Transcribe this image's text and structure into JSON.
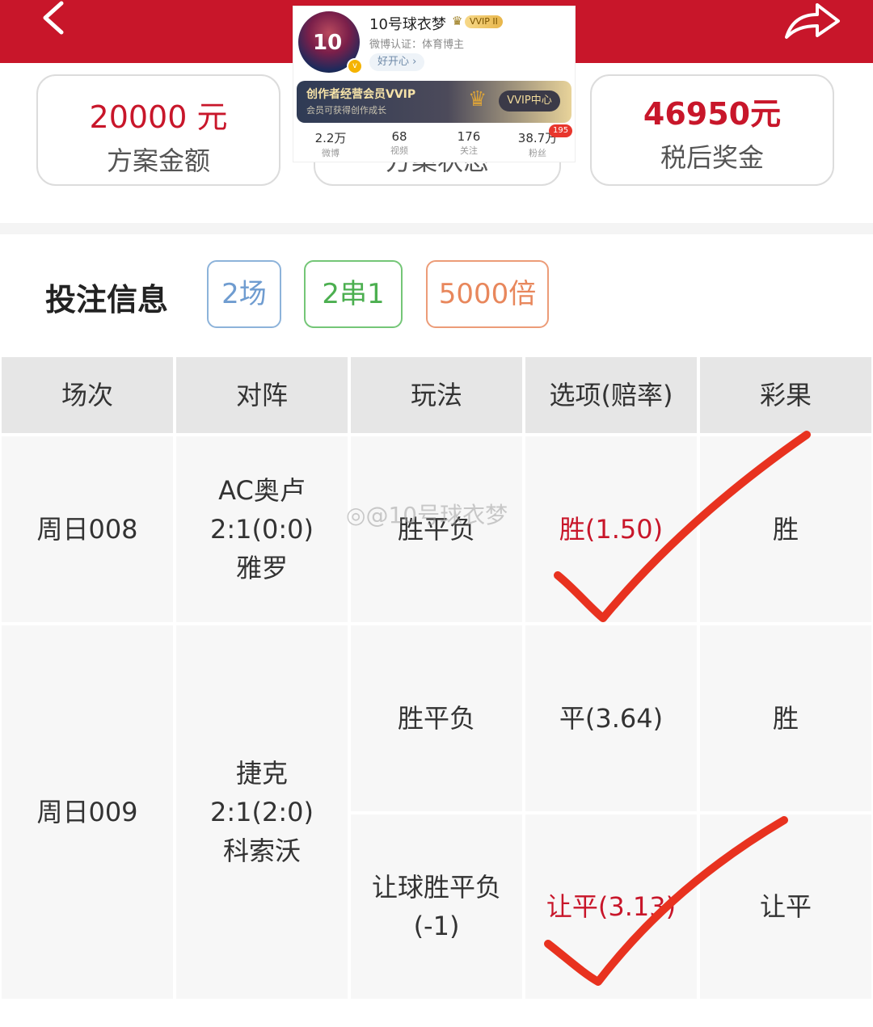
{
  "header": {
    "title": "",
    "back_icon": "chevron-left-icon",
    "share_icon": "share-arrow-icon",
    "color": "#c8162a"
  },
  "summary": {
    "amount_value": "20000 元",
    "amount_label": "方案金额",
    "status_value": "",
    "status_label": "方案状态",
    "prize_value": "46950元",
    "prize_label": "税后奖金"
  },
  "profile": {
    "name": "10号球衣梦",
    "vip": "VVIP II",
    "cert": "微博认证：体育博主",
    "mood": "好开心 ›",
    "avatar_number": "10",
    "banner_title": "创作者经营会员VVIP",
    "banner_sub": "会员可获得创作成长",
    "banner_button": "VVIP中心",
    "stats": [
      {
        "num": "2.2万",
        "label": "微博"
      },
      {
        "num": "68",
        "label": "视频"
      },
      {
        "num": "176",
        "label": "关注"
      },
      {
        "num": "38.7万",
        "label": "粉丝"
      }
    ],
    "fans_badge": "195"
  },
  "bet": {
    "title": "投注信息",
    "tag_games": "2场",
    "tag_combo": "2串1",
    "tag_multiplier": "5000倍",
    "watermark": "@10号球衣梦",
    "columns": [
      "场次",
      "对阵",
      "玩法",
      "选项(赔率)",
      "彩果"
    ],
    "rows": [
      {
        "round": "周日008",
        "home": "AC奥卢",
        "score": "2:1(0:0)",
        "away": "雅罗",
        "plays": [
          {
            "type": "胜平负",
            "type_sub": "",
            "option": "胜(1.50)",
            "result": "胜",
            "hit": true
          }
        ]
      },
      {
        "round": "周日009",
        "home": "捷克",
        "score": "2:1(2:0)",
        "away": "科索沃",
        "plays": [
          {
            "type": "胜平负",
            "type_sub": "",
            "option": "平(3.64)",
            "result": "胜",
            "hit": false
          },
          {
            "type": "让球胜平负",
            "type_sub": "(-1)",
            "option": "让平(3.13)",
            "result": "让平",
            "hit": true
          }
        ]
      }
    ]
  }
}
